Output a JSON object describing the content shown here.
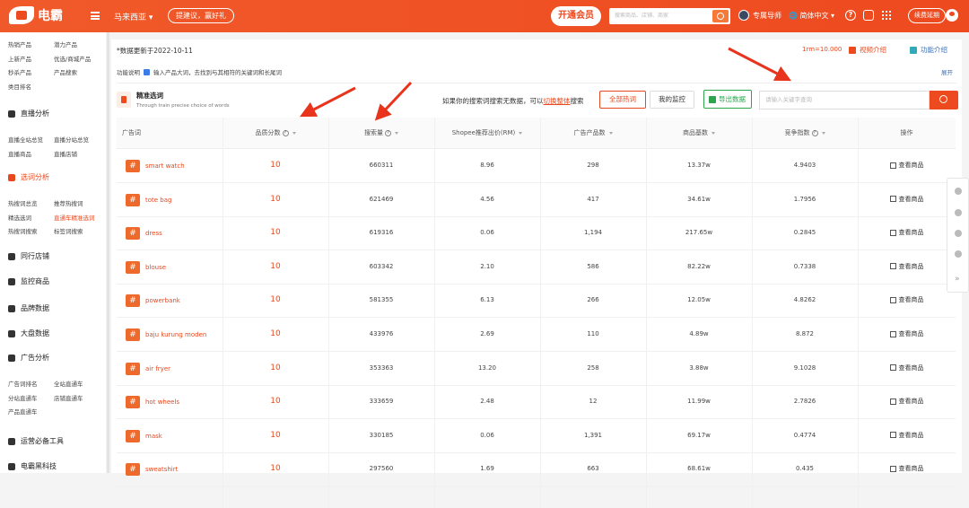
{
  "topbar": {
    "brand": "电霸",
    "region": "马来西亚",
    "suggest": "提建议，赢好礼",
    "open_member": "开通会员",
    "search_placeholder": "搜索商品、店铺、商家",
    "expert": "专属导师",
    "language": "简体中文",
    "renew": "续费延期"
  },
  "sidebar": {
    "top_items": [
      [
        "热销产品",
        "潜力产品"
      ],
      [
        "上新产品",
        "优选/商城产品"
      ],
      [
        "秒杀产品",
        "产品搜索"
      ],
      [
        "类目排名",
        ""
      ]
    ],
    "sections": [
      {
        "label": "直播分析",
        "items": [
          [
            "直播全站总览",
            "直播分站总览"
          ],
          [
            "直播商品",
            "直播店铺"
          ]
        ]
      },
      {
        "label": "选词分析",
        "items": [
          [
            "热搜词总览",
            "推荐热搜词"
          ],
          [
            "精选选词",
            "直通车精准选词"
          ],
          [
            "热搜词搜索",
            "标签词搜索"
          ]
        ]
      },
      {
        "label": "同行店铺",
        "items": []
      },
      {
        "label": "监控商品",
        "items": []
      },
      {
        "label": "品牌数据",
        "items": []
      },
      {
        "label": "大盘数据",
        "items": []
      },
      {
        "label": "广告分析",
        "items": [
          [
            "广告词排名",
            "全站直通车"
          ],
          [
            "分站直通车",
            "店铺直通车"
          ],
          [
            "产品直通车",
            ""
          ]
        ]
      },
      {
        "label": "运营必备工具",
        "items": []
      },
      {
        "label": "电霸黑科技",
        "items": []
      }
    ]
  },
  "main": {
    "updated": "*数据更新于2022-10-11",
    "rate": "1rm=10.000",
    "video_intro": "视频介绍",
    "func_intro": "功能介绍",
    "func_label": "功能说明",
    "func_text": "输入产品大词，去找到与其相符的关键词和长尾词",
    "expand": "展开",
    "pick_title": "精准选词",
    "pick_sub": "Through train precise choice of words",
    "hint_prefix": "如果你的搜索词搜索无数据，可以",
    "hint_link": "切换整体",
    "hint_suffix": "搜索",
    "btn_all": "全部热词",
    "btn_monitor": "我的监控",
    "btn_export": "导出数据",
    "kw_placeholder": "请输入关键字查询"
  },
  "table": {
    "headers": [
      "广告词",
      "品质分数",
      "搜索量",
      "Shopee推荐出价(RM)",
      "广告产品数",
      "商品基数",
      "竞争指数",
      "操作"
    ],
    "rows": [
      {
        "kw": "smart watch",
        "score": "10",
        "search": "660311",
        "bid": "8.96",
        "ads": "298",
        "base": "13.37w",
        "comp": "4.9403",
        "op": "查看商品"
      },
      {
        "kw": "tote bag",
        "score": "10",
        "search": "621469",
        "bid": "4.56",
        "ads": "417",
        "base": "34.61w",
        "comp": "1.7956",
        "op": "查看商品"
      },
      {
        "kw": "dress",
        "score": "10",
        "search": "619316",
        "bid": "0.06",
        "ads": "1,194",
        "base": "217.65w",
        "comp": "0.2845",
        "op": "查看商品"
      },
      {
        "kw": "blouse",
        "score": "10",
        "search": "603342",
        "bid": "2.10",
        "ads": "586",
        "base": "82.22w",
        "comp": "0.7338",
        "op": "查看商品"
      },
      {
        "kw": "powerbank",
        "score": "10",
        "search": "581355",
        "bid": "6.13",
        "ads": "266",
        "base": "12.05w",
        "comp": "4.8262",
        "op": "查看商品"
      },
      {
        "kw": "baju kurung moden",
        "score": "10",
        "search": "433976",
        "bid": "2.69",
        "ads": "110",
        "base": "4.89w",
        "comp": "8.872",
        "op": "查看商品"
      },
      {
        "kw": "air fryer",
        "score": "10",
        "search": "353363",
        "bid": "13.20",
        "ads": "258",
        "base": "3.88w",
        "comp": "9.1028",
        "op": "查看商品"
      },
      {
        "kw": "hot wheels",
        "score": "10",
        "search": "333659",
        "bid": "2.48",
        "ads": "12",
        "base": "11.99w",
        "comp": "2.7826",
        "op": "查看商品"
      },
      {
        "kw": "mask",
        "score": "10",
        "search": "330185",
        "bid": "0.06",
        "ads": "1,391",
        "base": "69.17w",
        "comp": "0.4774",
        "op": "查看商品"
      },
      {
        "kw": "sweatshirt",
        "score": "10",
        "search": "297560",
        "bid": "1.69",
        "ads": "663",
        "base": "68.61w",
        "comp": "0.435",
        "op": "查看商品"
      }
    ]
  },
  "colors": {
    "accent": "#ee4a1f",
    "arrow": "#e8341c"
  }
}
